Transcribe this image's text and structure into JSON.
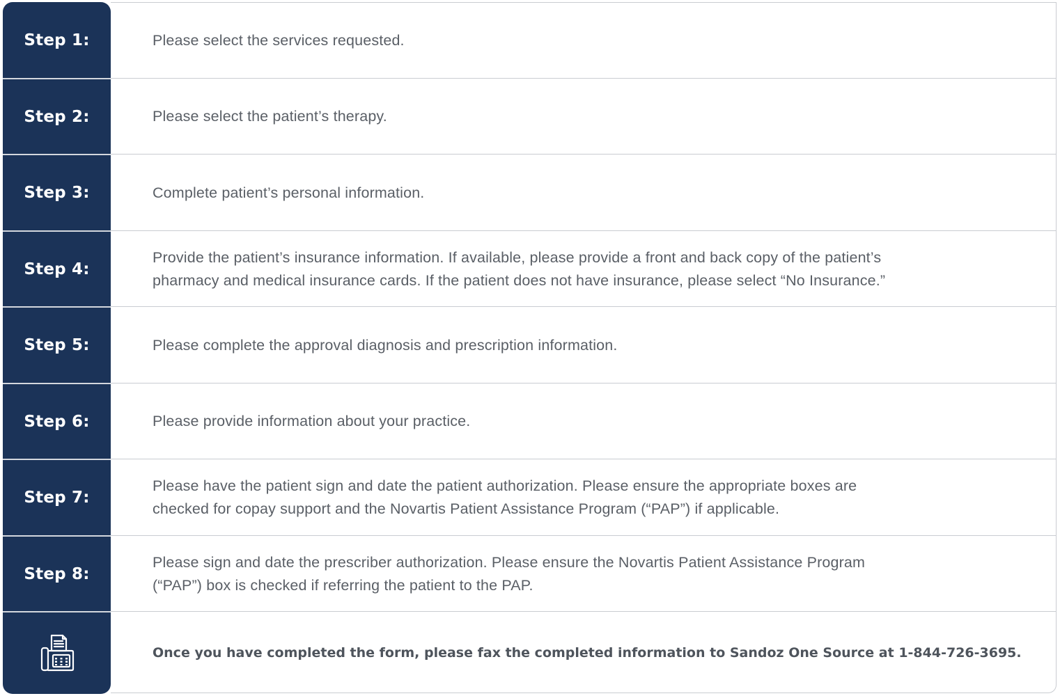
{
  "steps": [
    {
      "label": "Step 1:",
      "lines": [
        "Please select the services requested."
      ]
    },
    {
      "label": "Step 2:",
      "lines": [
        "Please select the patient’s therapy."
      ]
    },
    {
      "label": "Step 3:",
      "lines": [
        "Complete patient’s personal information."
      ]
    },
    {
      "label": "Step 4:",
      "lines": [
        "Provide the patient’s insurance information.  If available, please provide a front and back copy of the patient’s",
        "pharmacy and medical insurance cards.  If the patient does not have insurance, please select “No Insurance.”"
      ]
    },
    {
      "label": "Step 5:",
      "lines": [
        "Please complete the approval diagnosis and prescription information."
      ]
    },
    {
      "label": "Step 6:",
      "lines": [
        "Please provide information about your practice."
      ]
    },
    {
      "label": "Step 7:",
      "lines": [
        "Please have the patient sign and date the patient authorization.  Please ensure the appropriate boxes are",
        "checked for copay support and the Novartis Patient Assistance Program (“PAP”) if applicable."
      ]
    },
    {
      "label": "Step 8:",
      "lines": [
        "Please sign and date the prescriber authorization.  Please ensure the Novartis Patient Assistance Program",
        "(“PAP”) box is checked if referring the patient to the PAP."
      ]
    }
  ],
  "fax": {
    "icon": "fax-icon",
    "text": "Once you have completed the form, please fax the completed information to Sandoz One Source at 1-844-726-3695."
  },
  "colors": {
    "label_column": "#1b3358",
    "body_text": "#5a5f66",
    "divider": "#c9ccd1"
  }
}
